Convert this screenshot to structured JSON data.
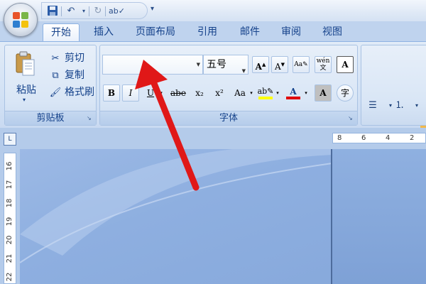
{
  "quick_access": {
    "items": [
      "save-icon",
      "undo-icon",
      "redo-icon",
      "spelling-icon"
    ]
  },
  "tabs": [
    "开始",
    "插入",
    "页面布局",
    "引用",
    "邮件",
    "审阅",
    "视图"
  ],
  "clipboard": {
    "paste_label": "粘贴",
    "cut_label": "剪切",
    "copy_label": "复制",
    "format_painter_label": "格式刷",
    "group_label": "剪贴板"
  },
  "font": {
    "font_name": "",
    "font_size": "五号",
    "bold": "B",
    "italic": "I",
    "strikethrough": "abe",
    "subscript": "x₂",
    "superscript": "x²",
    "change_case": "Aa",
    "group_label": "字体"
  },
  "ruler": {
    "corner": "L",
    "h_numbers": [
      "8",
      "6",
      "4",
      "2"
    ],
    "v_numbers": [
      "16",
      "17",
      "18",
      "19",
      "20",
      "21",
      "22"
    ]
  },
  "colors": {
    "highlight": "#ffff00",
    "font_color": "#e00000",
    "arrow": "#e01818"
  }
}
